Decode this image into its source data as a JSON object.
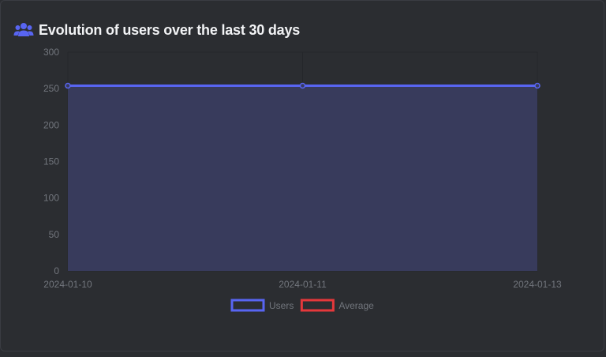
{
  "card": {
    "title": "Evolution of users over the last 30 days",
    "icon": "users-icon"
  },
  "colors": {
    "background": "#2b2d31",
    "users_line": "#5865f2",
    "users_fill": "#383b5c",
    "average_line": "#e5383b",
    "grid": "#3a3c42",
    "tick_text": "#72767d",
    "title_text": "#f2f3f5"
  },
  "chart_data": {
    "type": "line",
    "x": [
      "2024-01-10",
      "2024-01-11",
      "2024-01-13"
    ],
    "series": [
      {
        "name": "Users",
        "values": [
          254,
          254,
          254
        ],
        "filled": true
      },
      {
        "name": "Average",
        "values": [],
        "filled": false
      }
    ],
    "yticks": [
      0,
      50,
      100,
      150,
      200,
      250,
      300
    ],
    "ylim": [
      0,
      300
    ],
    "grid": true,
    "legend": "bottom-center"
  }
}
